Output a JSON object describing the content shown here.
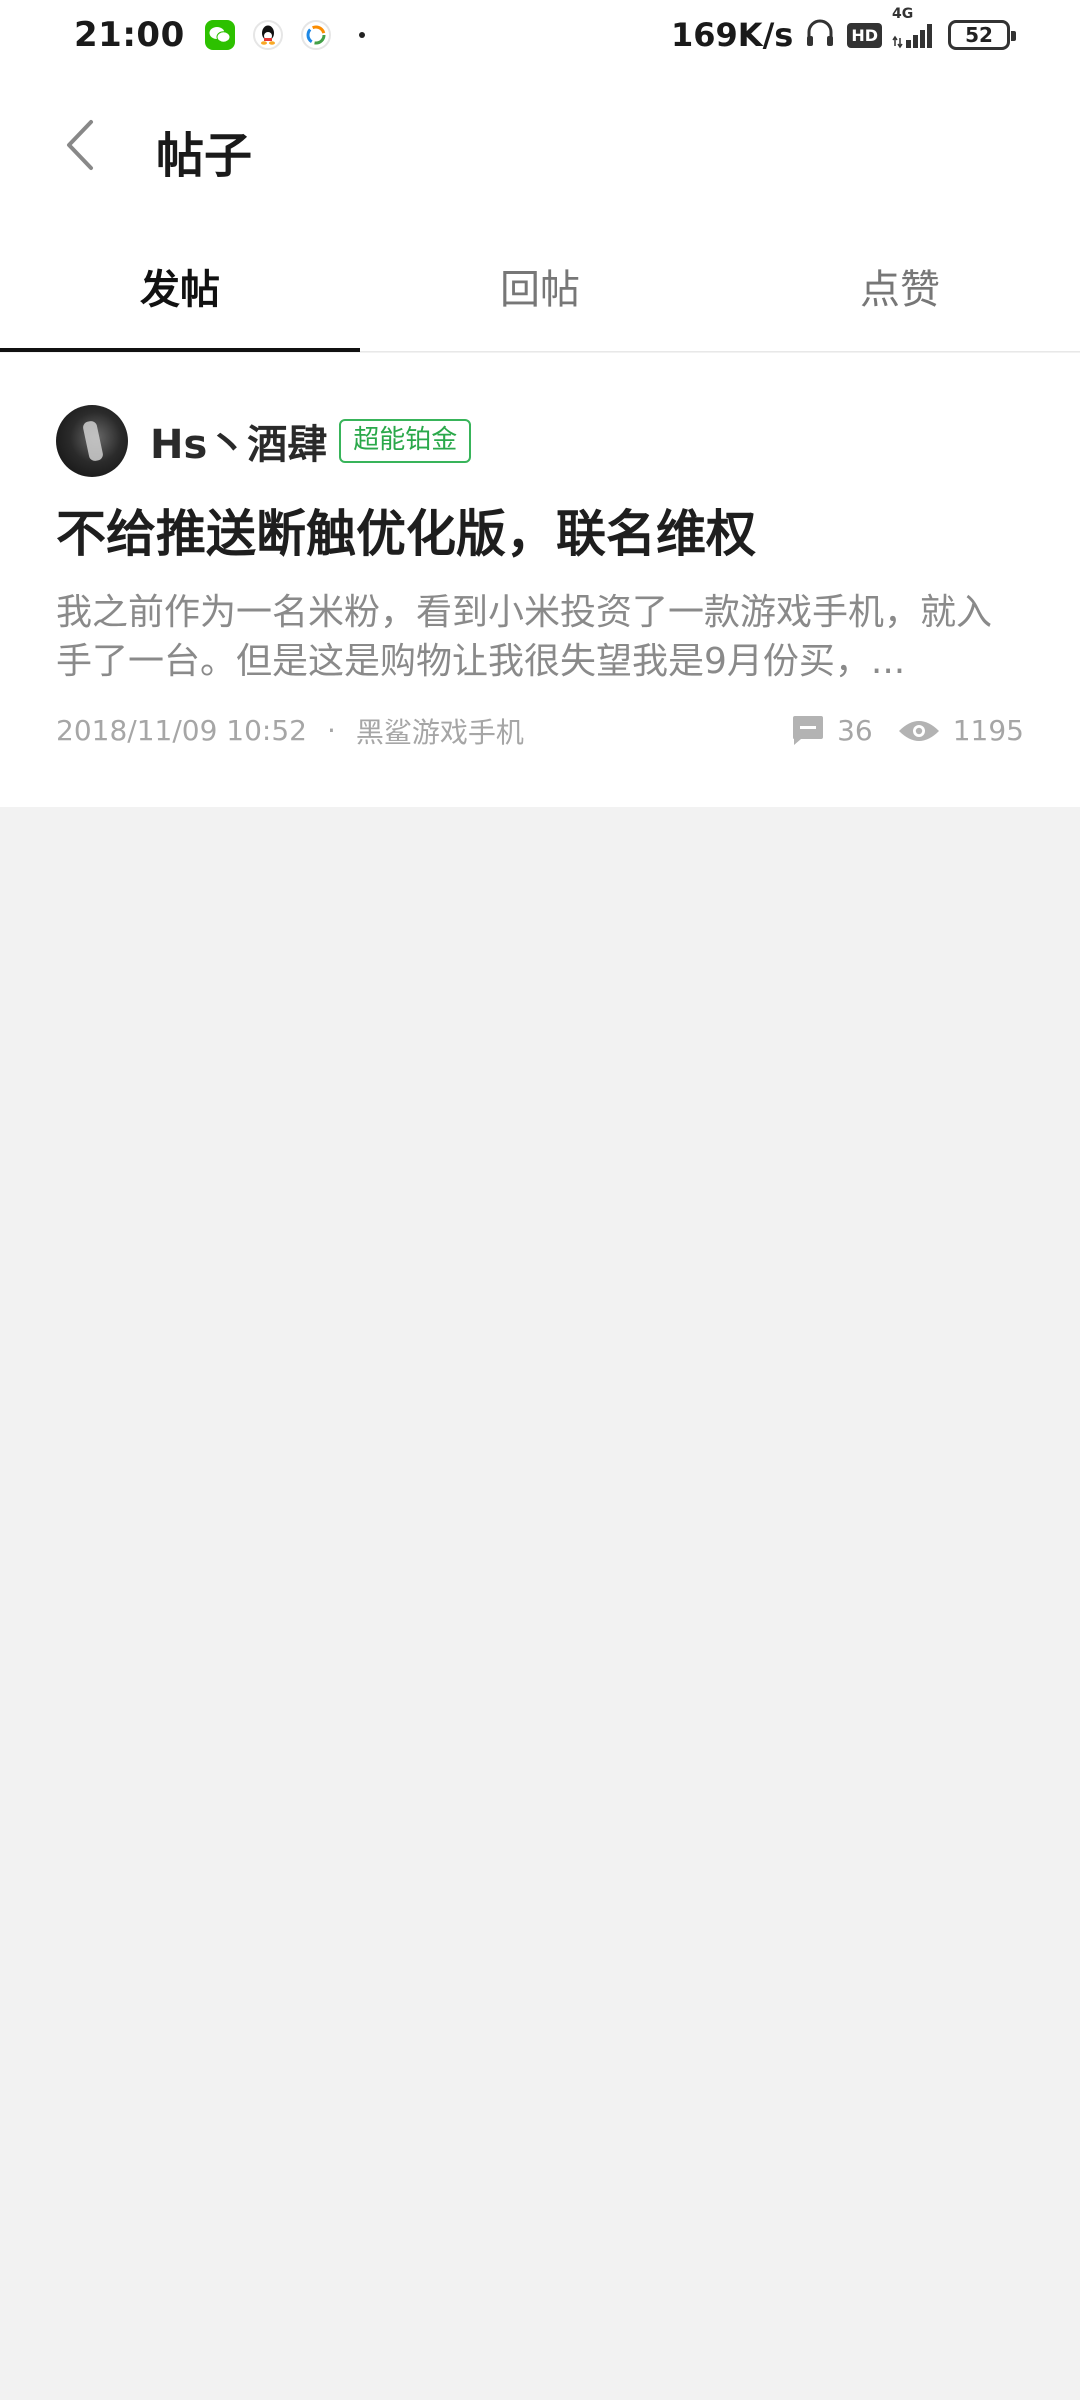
{
  "status_bar": {
    "time": "21:00",
    "notifications": [
      "wechat-icon",
      "qq-icon",
      "app-icon"
    ],
    "net_speed": "169K/s",
    "hd_label": "HD",
    "network": "4G",
    "battery": "52"
  },
  "header": {
    "back_icon": "chevron-left-icon",
    "title": "帖子"
  },
  "tabs": [
    {
      "label": "发帖",
      "active": true
    },
    {
      "label": "回帖",
      "active": false
    },
    {
      "label": "点赞",
      "active": false
    }
  ],
  "post": {
    "author": "Hs丶酒肆",
    "badge": "超能铂金",
    "title": "不给推送断触优化版，联名维权",
    "excerpt": "我之前作为一名米粉，看到小米投资了一款游戏手机，就入手了一台。但是这是购物让我很失望我是9月份买，...",
    "date": "2018/11/09 10:52",
    "separator": "·",
    "forum": "黑鲨游戏手机",
    "comments": "36",
    "views": "1195"
  },
  "colors": {
    "badge_green": "#2aa84a",
    "background": "#f2f2f2",
    "card": "#ffffff"
  }
}
